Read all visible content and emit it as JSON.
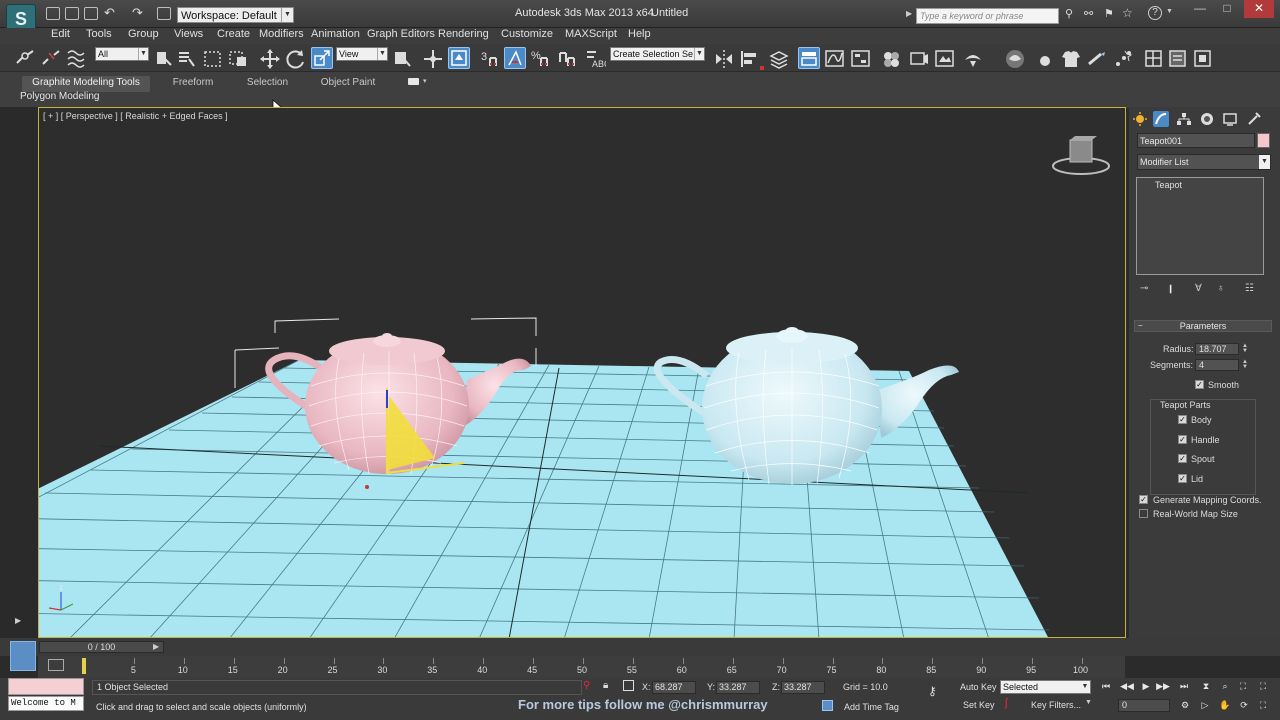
{
  "titlebar": {
    "app_logo": "S",
    "workspace": "Workspace: Default",
    "app_title": "Autodesk 3ds Max  2013 x64",
    "document": "Untitled",
    "search_placeholder": "Type a keyword or phrase",
    "window_buttons": [
      "—",
      "□",
      "✕"
    ]
  },
  "menu": {
    "items": [
      "Edit",
      "Tools",
      "Group",
      "Views",
      "Create",
      "Modifiers",
      "Animation",
      "Graph Editors",
      "Rendering",
      "Customize",
      "MAXScript",
      "Help"
    ]
  },
  "toolbar": {
    "selection_filter": "All",
    "reference_coord": "View",
    "named_selection": "Create Selection Se"
  },
  "ribbon": {
    "tabs": [
      "Graphite Modeling Tools",
      "Freeform",
      "Selection",
      "Object Paint"
    ],
    "panel_label": "Polygon Modeling"
  },
  "viewport": {
    "label": "[ + ] [ Perspective ] [ Realistic + Edged Faces ]",
    "grid_color": "#a9e6f2",
    "teapot_selected_color": "#f3c6cf",
    "teapot_other_color": "#d6f0f7"
  },
  "command_panel": {
    "object_name": "Teapot001",
    "object_color": "#f5c7cd",
    "modifier_list": "Modifier List",
    "stack_item": "Teapot",
    "params_title": "Parameters",
    "radius_label": "Radius:",
    "radius_value": "18.707",
    "segments_label": "Segments:",
    "segments_value": "4",
    "smooth_label": "Smooth",
    "teapot_parts_label": "Teapot Parts",
    "parts": [
      "Body",
      "Handle",
      "Spout",
      "Lid"
    ],
    "gen_mapping_label": "Generate Mapping Coords.",
    "real_world_label": "Real-World Map Size"
  },
  "timeline": {
    "slider": "0 / 100",
    "ticks": [
      "5",
      "10",
      "15",
      "20",
      "25",
      "30",
      "35",
      "40",
      "45",
      "50",
      "55",
      "60",
      "65",
      "70",
      "75",
      "80",
      "85",
      "90",
      "95",
      "100"
    ]
  },
  "status": {
    "maxscript_text": "Welcome to M",
    "selection_status": "1 Object Selected",
    "prompt": "Click and drag to select and scale objects (uniformly)",
    "x_label": "X:",
    "x_value": "68.287",
    "y_label": "Y:",
    "y_value": "33.287",
    "z_label": "Z:",
    "z_value": "33.287",
    "grid": "Grid = 10.0",
    "auto_key": "Auto Key",
    "selected": "Selected",
    "set_key": "Set Key",
    "key_filters": "Key Filters...",
    "add_time_tag": "Add Time Tag",
    "frame": "0",
    "watermark": "For more tips follow me @chrismmurray"
  }
}
